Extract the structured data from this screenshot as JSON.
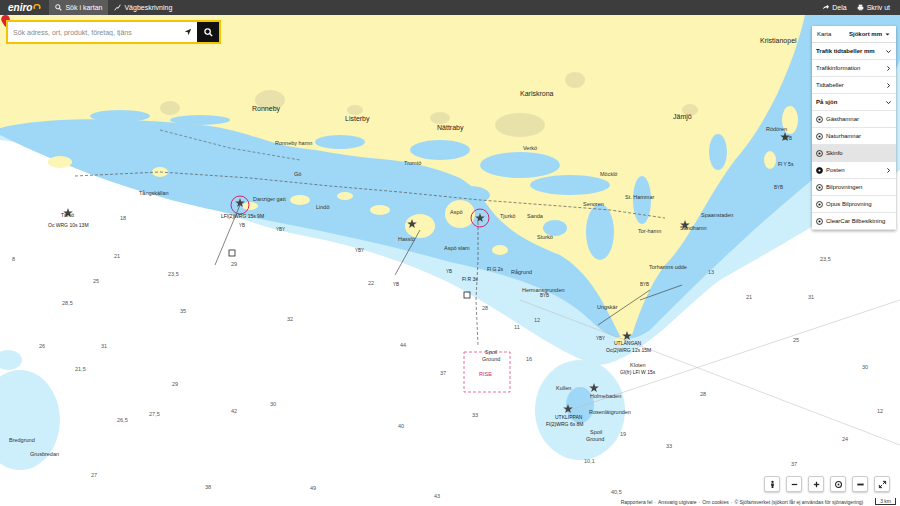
{
  "topbar": {
    "logo": "eniro",
    "tabs": [
      {
        "label": "Sök i kartan",
        "selected": true
      },
      {
        "label": "Vägbeskrivning",
        "selected": false
      }
    ],
    "actions": [
      "Dela",
      "Skriv ut"
    ]
  },
  "search": {
    "placeholder": "Sök adress, ort, produkt, företag, tjäns"
  },
  "panel": {
    "map_tabs": [
      {
        "label": "Karta",
        "selected": false
      },
      {
        "label": "Sjökort mm",
        "selected": true
      }
    ],
    "items": [
      {
        "label": "Trafik tidtabeller mm",
        "kind": "section",
        "expanded": true,
        "selected": false
      },
      {
        "label": "Trafikinformation",
        "kind": "submenu",
        "expanded": false,
        "selected": false
      },
      {
        "label": "Tidtabeller",
        "kind": "submenu",
        "expanded": false,
        "selected": false
      },
      {
        "label": "På sjön",
        "kind": "section",
        "expanded": true,
        "selected": false
      },
      {
        "label": "Gästhamnar",
        "kind": "layer",
        "expanded": false,
        "selected": false
      },
      {
        "label": "Naturhamnar",
        "kind": "layer",
        "expanded": false,
        "selected": false
      },
      {
        "label": "Skinfo",
        "kind": "layer",
        "expanded": false,
        "selected": true
      },
      {
        "label": "Posten",
        "kind": "group",
        "expanded": false,
        "selected": false
      },
      {
        "label": "Bilprovningen",
        "kind": "layer",
        "expanded": false,
        "selected": false
      },
      {
        "label": "Opus Bilprovning",
        "kind": "layer",
        "expanded": false,
        "selected": false
      },
      {
        "label": "ClearCar Bilbesiktning",
        "kind": "layer",
        "expanded": false,
        "selected": false
      }
    ]
  },
  "map": {
    "towns": [
      "Ronneby",
      "Karlskrona",
      "Nättraby",
      "Listerby",
      "Jämjö",
      "Kristianopel"
    ],
    "places": [
      "Ronneby hamn",
      "Tromtö",
      "Verkö",
      "Möcklö",
      "St. Hammar",
      "Senoren",
      "Tjurkö",
      "Sanda",
      "Sturkö",
      "Aspö",
      "Hasslö",
      "Aspö slam",
      "Gö",
      "Lindö",
      "Danziger gatt",
      "Tångskällan",
      "Rågrund",
      "Hermansgrunden",
      "Torhamns udde",
      "Tor-hamn",
      "Sandhamn",
      "Spaanstaden",
      "Ungskär",
      "Kloten",
      "Kullen",
      "Holmebaden",
      "Rosenlätgrunden",
      "Spoil",
      "Ground",
      "Spoil",
      "Ground",
      "Rödören",
      "Bredgrund",
      "Grusbredan"
    ],
    "lights": [
      "Tärnö",
      "Oc WRG 10s 13M",
      "LFl(2)WRG 15s 9M",
      "Fl R 3s",
      "Fl G 2s",
      "UTLÄNGAN",
      "Oc(2)WRG 12s 15M",
      "Gl(fr) LFl W 15s",
      "UTKLIPPAN",
      "Fl(2)WRG 6s 8M",
      "Fl Y 5s"
    ],
    "buoys": [
      "YB",
      "YBY",
      "YBY",
      "YB",
      "YB",
      "BYB",
      "YBY",
      "BYB",
      "BYB",
      "BYB"
    ],
    "depths": [
      "8",
      "18",
      "21",
      "23,5",
      "25",
      "29",
      "28,5",
      "35",
      "22",
      "31",
      "26",
      "21,5",
      "29",
      "27,5",
      "26,5",
      "42",
      "30",
      "32",
      "44",
      "37",
      "40",
      "33",
      "27",
      "38",
      "49",
      "28",
      "11",
      "12",
      "16",
      "19",
      "10,1",
      "33",
      "40,5",
      "43",
      "28",
      "21",
      "13",
      "23,5",
      "25",
      "30",
      "12",
      "24",
      "37",
      "31"
    ],
    "areas": [
      "RISE"
    ]
  },
  "footer": {
    "links": [
      "Rapportera fel",
      "Ansvarig utgivare",
      "Om cookies"
    ],
    "separator": "·",
    "copyright": "© Sjöfartsverket (sjökort får ej användas för sjönavigering)",
    "scale": "3 km"
  }
}
